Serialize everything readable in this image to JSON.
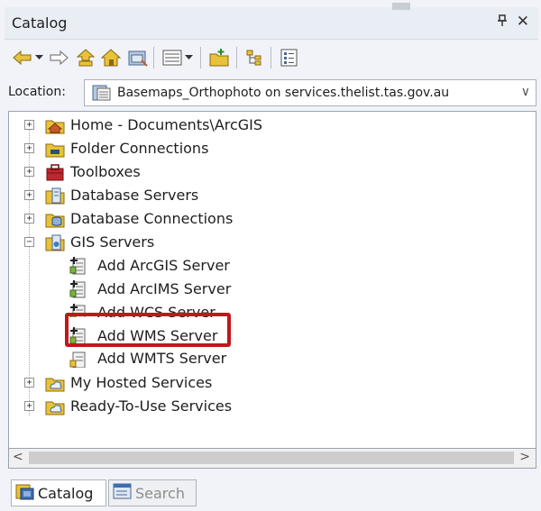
{
  "window": {
    "title": "Catalog",
    "pin_glyph": "Ȩ",
    "close_glyph": "✕"
  },
  "toolbar": {
    "items": [
      {
        "icon": "back-arrow-icon"
      },
      {
        "icon": "dropdown-arrow-icon"
      },
      {
        "icon": "forward-arrow-icon"
      },
      {
        "icon": "up-one-level-icon"
      },
      {
        "icon": "home-icon"
      },
      {
        "icon": "connect-folder-icon"
      },
      {
        "icon": "view-options-icon"
      },
      {
        "icon": "dropdown-arrow-icon"
      },
      {
        "icon": "add-folder-icon"
      },
      {
        "icon": "toggle-tree-icon"
      },
      {
        "icon": "contents-list-icon"
      }
    ]
  },
  "location": {
    "label": "Location:",
    "value": "Basemaps_Orthophoto on services.thelist.tas.gov.au",
    "dropdown_glyph": "∨"
  },
  "tree": {
    "items": [
      {
        "label": "Home - Documents\\ArcGIS",
        "expander": "+",
        "icon": "home-folder-icon"
      },
      {
        "label": "Folder Connections",
        "expander": "+",
        "icon": "folder-connections-icon"
      },
      {
        "label": "Toolboxes",
        "expander": "+",
        "icon": "toolbox-icon"
      },
      {
        "label": "Database Servers",
        "expander": "+",
        "icon": "database-server-icon"
      },
      {
        "label": "Database Connections",
        "expander": "+",
        "icon": "database-connection-icon"
      },
      {
        "label": "GIS Servers",
        "expander": "−",
        "icon": "gis-servers-icon"
      },
      {
        "label": "Add ArcGIS Server",
        "icon": "add-server-icon"
      },
      {
        "label": "Add ArcIMS Server",
        "icon": "add-server-icon"
      },
      {
        "label": "Add WCS Server",
        "icon": "add-server-icon"
      },
      {
        "label": "Add WMS Server",
        "icon": "add-server-icon"
      },
      {
        "label": "Add WMTS Server",
        "icon": "add-server-icon"
      },
      {
        "label": "My Hosted Services",
        "expander": "+",
        "icon": "hosted-services-icon"
      },
      {
        "label": "Ready-To-Use Services",
        "expander": "+",
        "icon": "ready-to-use-services-icon"
      }
    ],
    "highlighted_item": "Add WMS Server",
    "highlight_color": "#c0181a"
  },
  "scrollbar": {
    "left_glyph": "<",
    "right_glyph": ">"
  },
  "tabs": [
    {
      "label": "Catalog",
      "active": true,
      "icon": "catalog-icon"
    },
    {
      "label": "Search",
      "active": false,
      "icon": "search-window-icon"
    }
  ]
}
